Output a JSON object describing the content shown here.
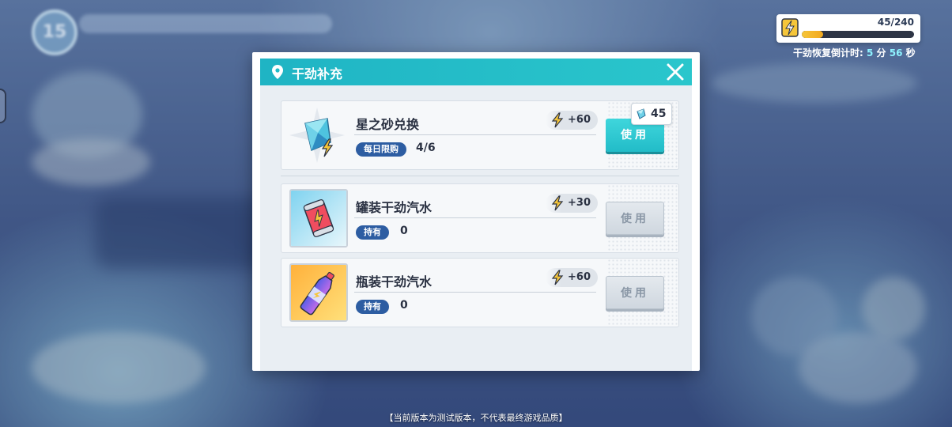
{
  "hud": {
    "level": "15",
    "energy_current": "45/240",
    "energy_fraction": 0.1875,
    "recover_label": "干劲恢复倒计时:",
    "recover_min": "5",
    "recover_min_unit": "分",
    "recover_sec": "56",
    "recover_sec_unit": "秒"
  },
  "modal": {
    "title": "干劲补充",
    "close_icon": "close-icon"
  },
  "items": [
    {
      "name": "星之砂兑换",
      "gain": "+60",
      "tag": "每日限购",
      "tag_value": "4/6",
      "button": "使用",
      "button_state": "active",
      "cost": "45",
      "icon": "star-sand-crystal-icon"
    },
    {
      "name": "罐装干劲汽水",
      "gain": "+30",
      "tag": "持有",
      "tag_value": "0",
      "button": "使用",
      "button_state": "disabled",
      "icon": "canned-soda-icon"
    },
    {
      "name": "瓶装干劲汽水",
      "gain": "+60",
      "tag": "持有",
      "tag_value": "0",
      "button": "使用",
      "button_state": "disabled",
      "icon": "bottled-soda-icon"
    }
  ],
  "notice": "【当前版本为测试版本，不代表最终游戏品质】",
  "colors": {
    "header": "#22bcc8",
    "tag": "#2d5da2",
    "energy": "#f6c63a",
    "active_button": "#22bcc8"
  }
}
